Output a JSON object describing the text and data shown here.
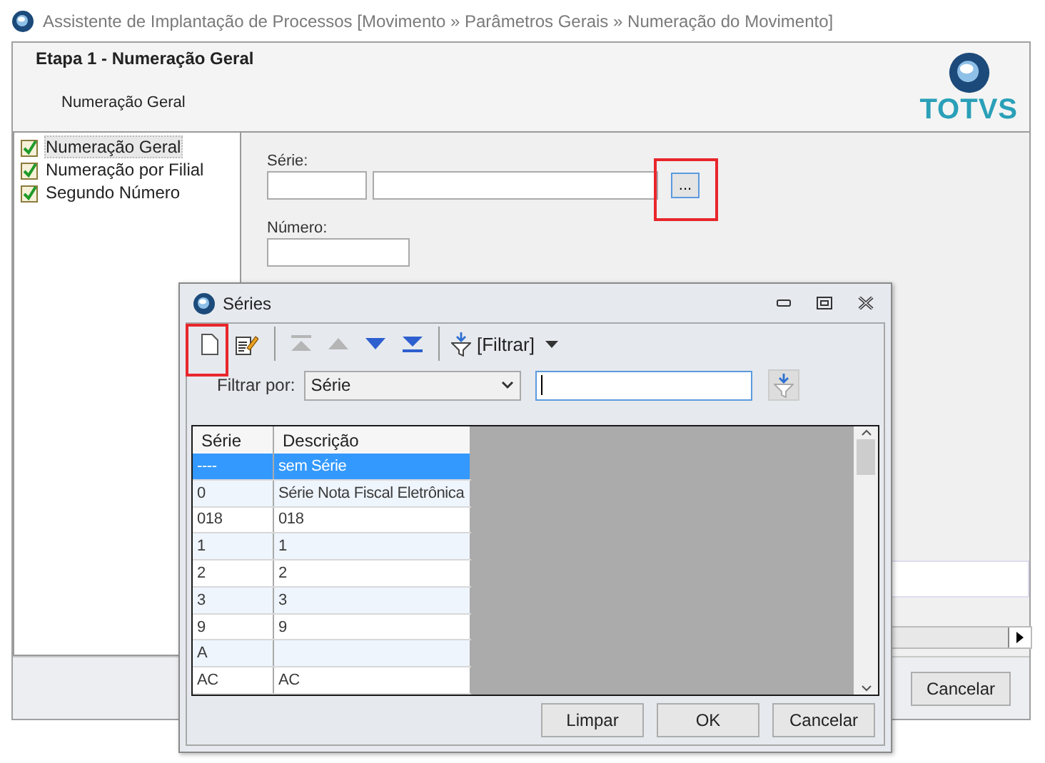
{
  "window": {
    "title": "Assistente de Implantação de Processos [Movimento » Parâmetros Gerais » Numeração do Movimento]"
  },
  "header": {
    "step_title": "Etapa 1 - Numeração Geral",
    "subtitle": "Numeração Geral",
    "logo_text": "TOTVS"
  },
  "steps": [
    {
      "label": "Numeração Geral",
      "checked": true,
      "selected": true
    },
    {
      "label": "Numeração por Filial",
      "checked": true,
      "selected": false
    },
    {
      "label": "Segundo Número",
      "checked": true,
      "selected": false
    }
  ],
  "form": {
    "serie_label": "Série:",
    "lookup_button": "...",
    "numero_label": "Número:"
  },
  "footer": {
    "buttons": [
      "Cancelar"
    ]
  },
  "dialog": {
    "title": "Séries",
    "tools": [
      {
        "kind": "new",
        "disabled": false
      },
      {
        "kind": "edit",
        "disabled": false
      },
      {
        "kind": "first",
        "disabled": true
      },
      {
        "kind": "previous",
        "disabled": true
      },
      {
        "kind": "next",
        "disabled": false
      },
      {
        "kind": "last",
        "disabled": false
      }
    ],
    "filter_menu": "[Filtrar]",
    "filter": {
      "label": "Filtrar por:",
      "field": "Série"
    },
    "columns": [
      "Série",
      "Descrição"
    ],
    "rows": [
      {
        "serie": "----",
        "descricao": "sem Série",
        "selected": true
      },
      {
        "serie": "0",
        "descricao": "Série Nota Fiscal Eletrônica",
        "selected": false
      },
      {
        "serie": "018",
        "descricao": "018",
        "selected": false
      },
      {
        "serie": "1",
        "descricao": "1",
        "selected": false
      },
      {
        "serie": "2",
        "descricao": "2",
        "selected": false
      },
      {
        "serie": "3",
        "descricao": "3",
        "selected": false
      },
      {
        "serie": "9",
        "descricao": "9",
        "selected": false
      },
      {
        "serie": "A",
        "descricao": "",
        "selected": false
      },
      {
        "serie": "AC",
        "descricao": "AC",
        "selected": false
      }
    ],
    "buttons": [
      "Limpar",
      "OK",
      "Cancelar"
    ]
  }
}
